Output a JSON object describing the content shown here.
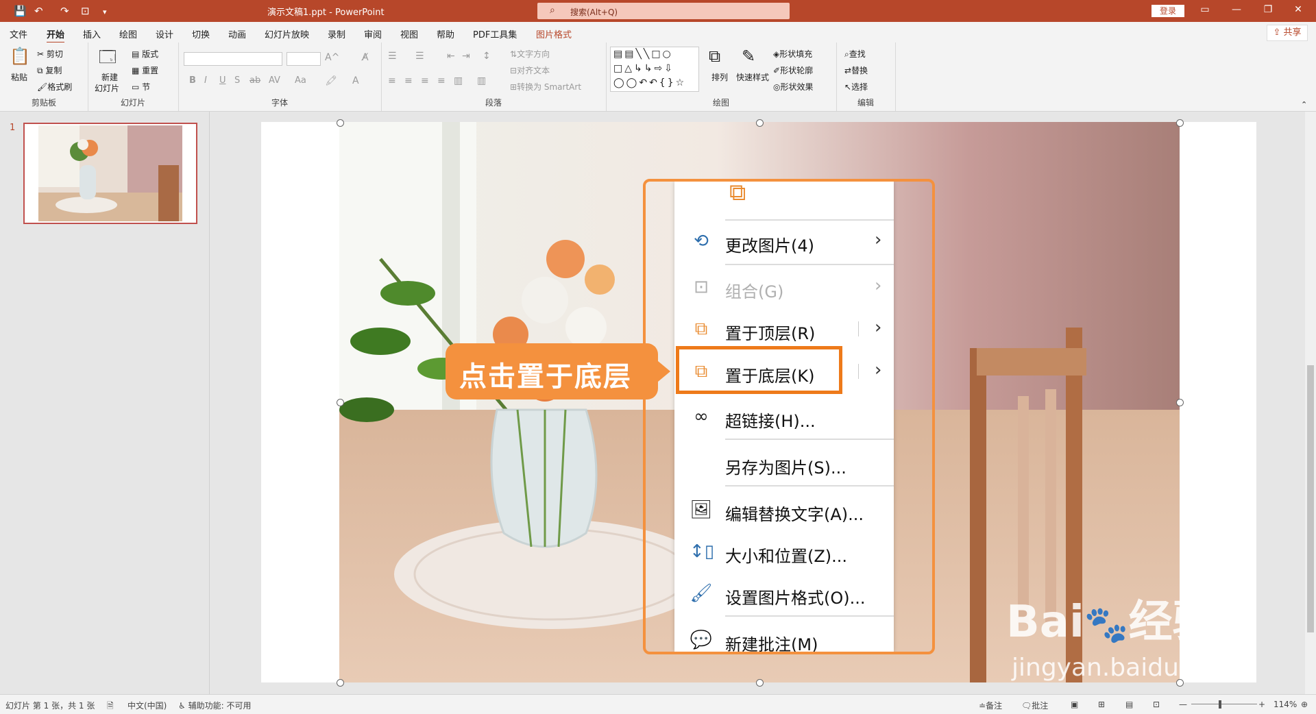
{
  "titlebar": {
    "filename": "演示文稿1.ppt",
    "separator": "-",
    "app": "PowerPoint",
    "search_placeholder": "搜索(Alt+Q)",
    "login": "登录"
  },
  "tabs": [
    "文件",
    "开始",
    "插入",
    "绘图",
    "设计",
    "切换",
    "动画",
    "幻灯片放映",
    "录制",
    "审阅",
    "视图",
    "帮助",
    "PDF工具集",
    "图片格式"
  ],
  "share": "共享",
  "ribbon": {
    "clipboard": {
      "paste": "粘贴",
      "cut": "剪切",
      "copy": "复制",
      "format_painter": "格式刷",
      "label": "剪贴板"
    },
    "slides": {
      "new_line1": "新建",
      "new_line2": "幻灯片",
      "layout": "版式",
      "reset": "重置",
      "section": "节",
      "label": "幻灯片"
    },
    "font": {
      "label": "字体"
    },
    "paragraph": {
      "text_direction": "文字方向",
      "align_text": "对齐文本",
      "smartart": "转换为 SmartArt",
      "label": "段落"
    },
    "drawing": {
      "arrange": "排列",
      "quick_styles": "快速样式",
      "shape_fill": "形状填充",
      "shape_outline": "形状轮廓",
      "shape_effects": "形状效果",
      "label": "绘图"
    },
    "editing": {
      "find": "查找",
      "replace": "替换",
      "select": "选择",
      "label": "编辑"
    }
  },
  "slide_panel": {
    "number": "1"
  },
  "menu": {
    "items": [
      {
        "label": "更改图片(4)",
        "icon": "change-picture-icon",
        "submenu": true
      },
      {
        "label": "组合(G)",
        "icon": "group-icon",
        "submenu": true,
        "disabled": true
      },
      {
        "label": "置于顶层(R)",
        "icon": "bring-to-front-icon",
        "submenu": true
      },
      {
        "label": "置于底层(K)",
        "icon": "send-to-back-icon",
        "submenu": true,
        "highlighted": true
      },
      {
        "label": "超链接(H)...",
        "icon": "link-icon"
      },
      {
        "label": "另存为图片(S)...",
        "icon": ""
      },
      {
        "label": "编辑替换文字(A)...",
        "icon": "alt-text-icon"
      },
      {
        "label": "大小和位置(Z)...",
        "icon": "size-position-icon"
      },
      {
        "label": "设置图片格式(O)...",
        "icon": "format-picture-icon"
      },
      {
        "label": "新建批注(M)",
        "icon": "new-comment-icon"
      }
    ]
  },
  "callout": "点击置于底层",
  "watermark": {
    "line1": "Bai",
    "paw": "du",
    "cn": "经验",
    "line2": "jingyan.baidu.com"
  },
  "statusbar": {
    "slide_info": "幻灯片 第 1 张，共 1 张",
    "language": "中文(中国)",
    "accessibility": "辅助功能: 不可用",
    "notes": "备注",
    "comments": "批注",
    "zoom": "114%"
  },
  "colors": {
    "accent": "#b7472a",
    "callout": "#f4913e",
    "highlight": "#ee7a1a"
  }
}
